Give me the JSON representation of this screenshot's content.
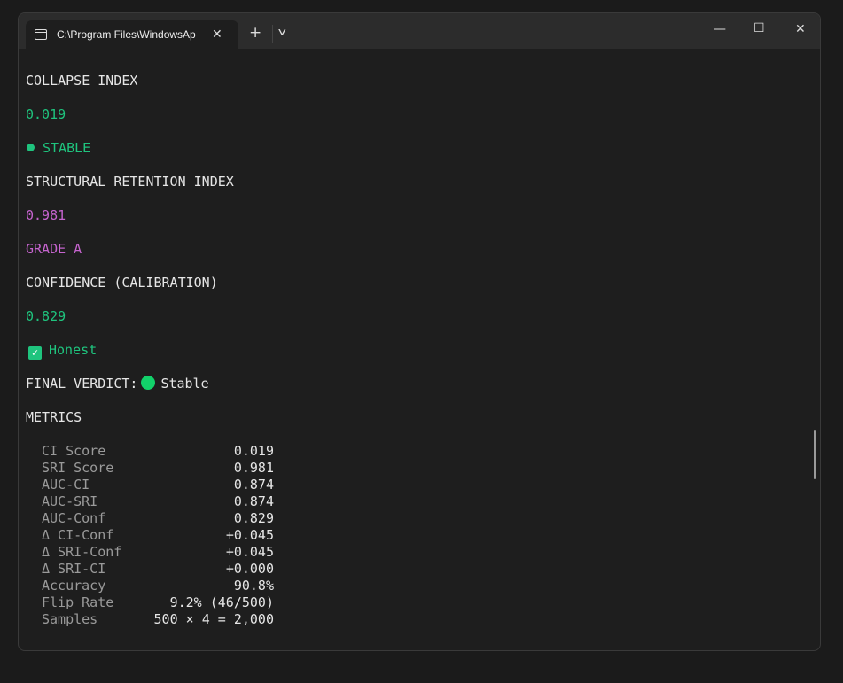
{
  "tab": {
    "title": "C:\\Program Files\\WindowsAp",
    "icon": "terminal-icon"
  },
  "colors": {
    "green": "#1fc47e",
    "purple": "#c664cf",
    "verdict_dot": "#12d16a"
  },
  "terminal": {
    "collapse_heading": "COLLAPSE INDEX",
    "collapse_value": "0.019",
    "collapse_status": "STABLE",
    "sri_heading": "STRUCTURAL RETENTION INDEX",
    "sri_value": "0.981",
    "sri_grade": "GRADE A",
    "conf_heading": "CONFIDENCE (CALIBRATION)",
    "conf_value": "0.829",
    "conf_status": "Honest",
    "verdict_label": "FINAL VERDICT:",
    "verdict_value": "Stable",
    "metrics_heading": "METRICS",
    "metrics": [
      {
        "label": "CI Score",
        "value": "0.019"
      },
      {
        "label": "SRI Score",
        "value": "0.981"
      },
      {
        "label": "AUC-CI",
        "value": "0.874"
      },
      {
        "label": "AUC-SRI",
        "value": "0.874"
      },
      {
        "label": "AUC-Conf",
        "value": "0.829"
      },
      {
        "label": "Δ CI-Conf",
        "value": "+0.045"
      },
      {
        "label": "Δ SRI-Conf",
        "value": "+0.045"
      },
      {
        "label": "Δ SRI-CI",
        "value": "+0.000"
      },
      {
        "label": "Accuracy",
        "value": "90.8%"
      },
      {
        "label": "Flip Rate",
        "value": "9.2% (46/500)"
      },
      {
        "label": "Samples",
        "value": "500 × 4 = 2,000"
      }
    ]
  }
}
